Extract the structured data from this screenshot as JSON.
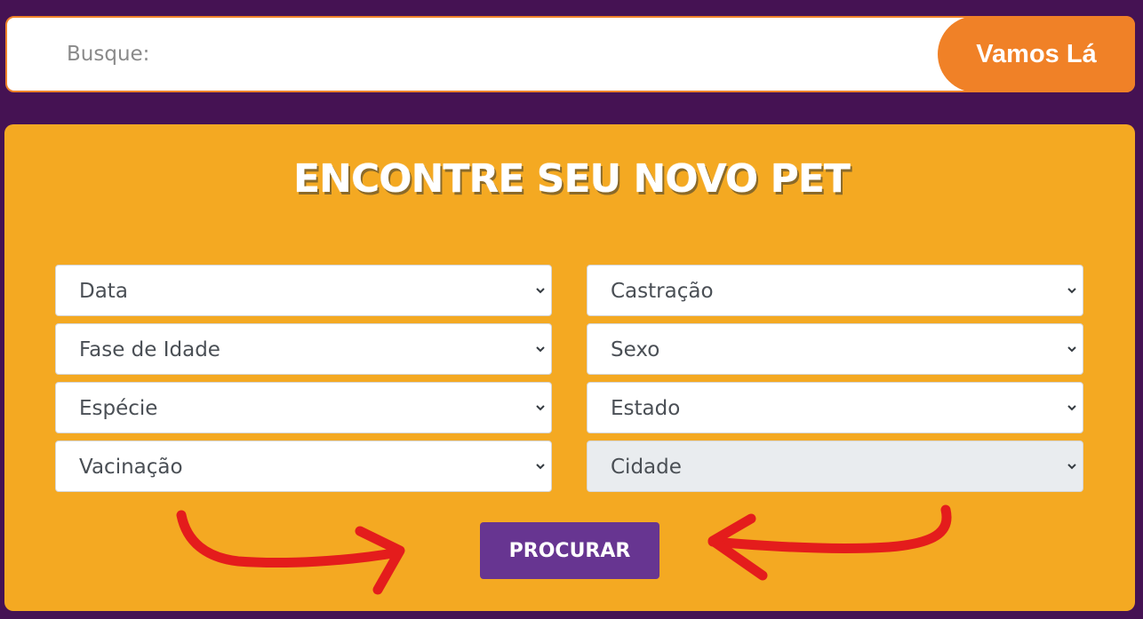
{
  "search": {
    "placeholder": "Busque:",
    "button_label": "Vamos Lá"
  },
  "filters": {
    "title": "ENCONTRE SEU NOVO PET",
    "left_column": [
      {
        "label": "Data"
      },
      {
        "label": "Fase de Idade"
      },
      {
        "label": "Espécie"
      },
      {
        "label": "Vacinação"
      }
    ],
    "right_column": [
      {
        "label": "Castração"
      },
      {
        "label": "Sexo"
      },
      {
        "label": "Estado"
      },
      {
        "label": "Cidade",
        "disabled": true
      }
    ],
    "submit_label": "PROCURAR"
  },
  "icons": {
    "select_chevron": "chevron-down-icon",
    "annotation_arrows": "red-hand-drawn-arrow"
  },
  "colors": {
    "page_background": "#451253",
    "panel_background": "#f4a922",
    "search_button": "#f08127",
    "submit_button": "#673591",
    "annotation": "#e41c1c"
  }
}
